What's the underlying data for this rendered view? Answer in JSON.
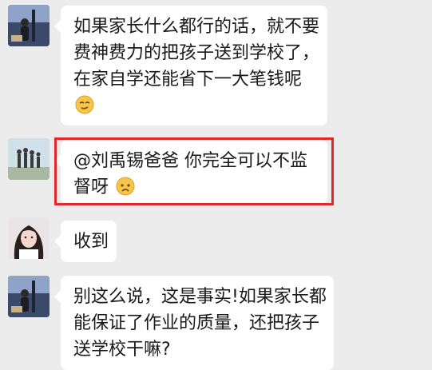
{
  "messages": [
    {
      "lines": [
        "如果家长什么都行的话，就不要",
        "费神费力的把孩子送到学校了，",
        "在家自学还能省下一大笔钱呢"
      ],
      "emoji": "smirk-face-emoji"
    },
    {
      "lines": [
        "@刘禹锡爸爸  你完全可以不监",
        "督呀"
      ],
      "emoji": "worried-face-emoji"
    },
    {
      "lines": [
        "收到"
      ]
    },
    {
      "lines": [
        "别这么说，这是事实!如果家长都",
        "能保证了作业的质量，还把孩子",
        "送学校干嘛?"
      ]
    }
  ],
  "colors": {
    "background": "#ececec",
    "bubble": "#ffffff",
    "highlight": "#e3282a"
  }
}
